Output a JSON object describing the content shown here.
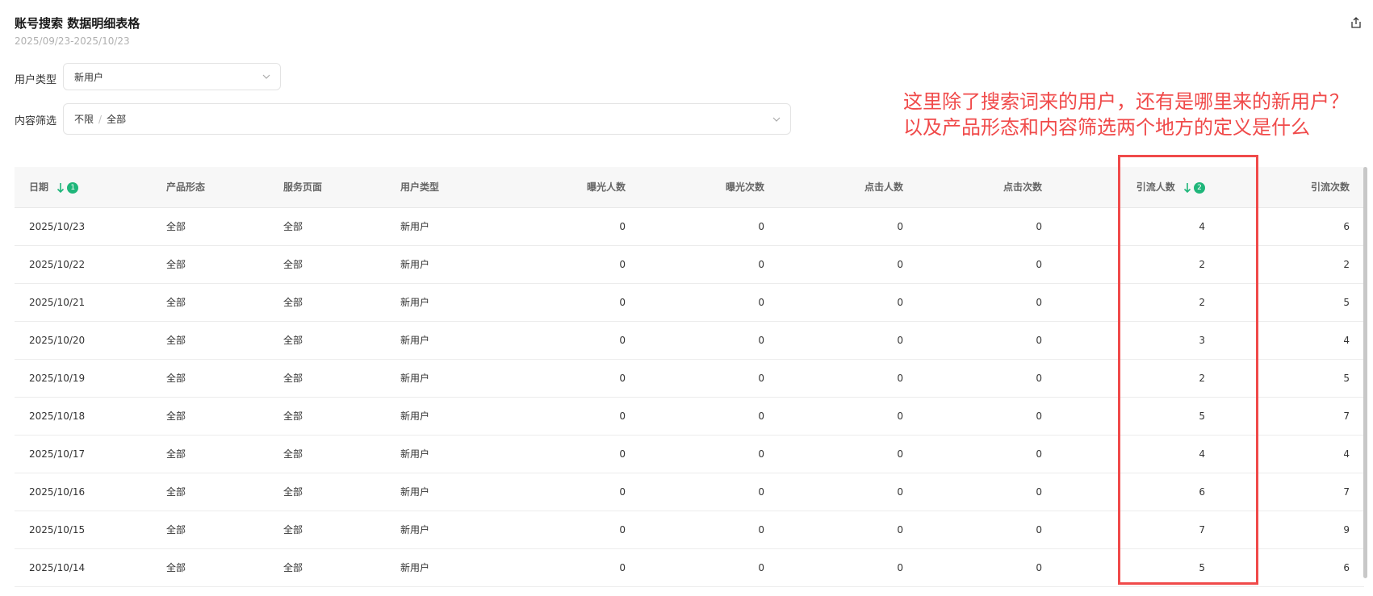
{
  "header": {
    "title": "账号搜索 数据明细表格",
    "date_range": "2025/09/23-2025/10/23"
  },
  "filters": {
    "user_type": {
      "label": "用户类型",
      "value": "新用户"
    },
    "content": {
      "label": "内容筛选",
      "value_primary": "不限",
      "separator": "/",
      "value_secondary": "全部"
    }
  },
  "annotation": {
    "line1": "这里除了搜索词来的用户，还有是哪里来的新用户？",
    "line2": "以及产品形态和内容筛选两个地方的定义是什么",
    "color": "#f04a4a"
  },
  "table": {
    "columns": [
      "日期",
      "产品形态",
      "服务页面",
      "用户类型",
      "曝光人数",
      "曝光次数",
      "点击人数",
      "点击次数",
      "引流人数",
      "引流次数"
    ],
    "sort_badges": {
      "date": "1",
      "traffic_users": "2"
    },
    "rows": [
      [
        "2025/10/23",
        "全部",
        "全部",
        "新用户",
        "0",
        "0",
        "0",
        "0",
        "4",
        "6"
      ],
      [
        "2025/10/22",
        "全部",
        "全部",
        "新用户",
        "0",
        "0",
        "0",
        "0",
        "2",
        "2"
      ],
      [
        "2025/10/21",
        "全部",
        "全部",
        "新用户",
        "0",
        "0",
        "0",
        "0",
        "2",
        "5"
      ],
      [
        "2025/10/20",
        "全部",
        "全部",
        "新用户",
        "0",
        "0",
        "0",
        "0",
        "3",
        "4"
      ],
      [
        "2025/10/19",
        "全部",
        "全部",
        "新用户",
        "0",
        "0",
        "0",
        "0",
        "2",
        "5"
      ],
      [
        "2025/10/18",
        "全部",
        "全部",
        "新用户",
        "0",
        "0",
        "0",
        "0",
        "5",
        "7"
      ],
      [
        "2025/10/17",
        "全部",
        "全部",
        "新用户",
        "0",
        "0",
        "0",
        "0",
        "4",
        "4"
      ],
      [
        "2025/10/16",
        "全部",
        "全部",
        "新用户",
        "0",
        "0",
        "0",
        "0",
        "6",
        "7"
      ],
      [
        "2025/10/15",
        "全部",
        "全部",
        "新用户",
        "0",
        "0",
        "0",
        "0",
        "7",
        "9"
      ],
      [
        "2025/10/14",
        "全部",
        "全部",
        "新用户",
        "0",
        "0",
        "0",
        "0",
        "5",
        "6"
      ]
    ]
  },
  "colors": {
    "accent": "#1fb67a",
    "annotation": "#f04a4a"
  },
  "icons": {
    "export": "export-icon",
    "chevron": "chevron-down-icon",
    "sort": "sort-desc-icon"
  }
}
